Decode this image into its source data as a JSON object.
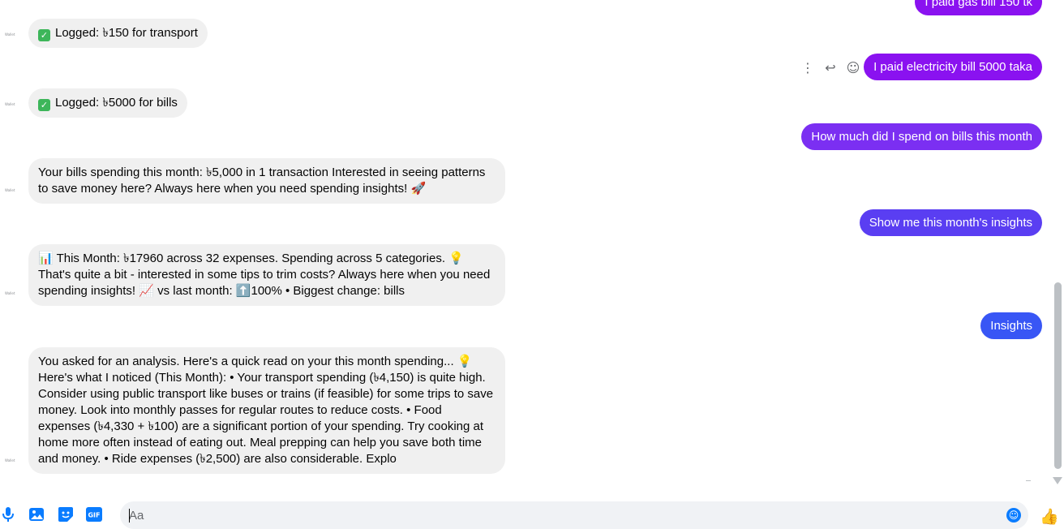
{
  "messages": {
    "out0": "I paid gas bill 150 tk",
    "in0": "Logged: ৳150 for transport",
    "out1": "I paid electricity bill 5000 taka",
    "in1": "Logged: ৳5000 for bills",
    "out2": "How much did I spend on bills this month",
    "in2": "Your bills spending this month: ৳5,000 in 1 transaction Interested in seeing patterns to save money here? Always here when you need spending insights! 🚀",
    "out3": "Show me this month's insights",
    "in3": "📊 This Month: ৳17960 across 32 expenses. Spending across 5 categories. 💡 That's quite a bit - interested in some tips to trim costs? Always here when you need spending insights! 📈 vs last month: ⬆️100% • Biggest change: bills",
    "out4": "Insights",
    "in4": "You asked for an analysis. Here's a quick read on your this month spending... 💡 Here's what I noticed (This Month): • Your transport spending (৳4,150) is quite high. Consider using public transport like buses or trains (if feasible) for some trips to save money. Look into monthly passes for regular routes to reduce costs. • Food expenses (৳4,330 + ৳100) are a significant portion of your spending. Try cooking at home more often instead of eating out. Meal prepping can help you save both time and money. • Ridе expenses (৳2,500) are also considerable. Explo"
  },
  "avatar_label": "Wallet",
  "composer": {
    "placeholder": "Aa"
  },
  "colors": {
    "incoming_bg": "#f0f0f0",
    "outgoing_purple": "#8a12f0",
    "outgoing_violet": "#7b2ff2",
    "outgoing_indigo": "#5a3ef2",
    "outgoing_blue": "#3856f5",
    "accent": "#0a7cff"
  },
  "icons": [
    "microphone-icon",
    "image-icon",
    "sticker-icon",
    "gif-icon",
    "emoji-icon",
    "thumbs-up-icon",
    "more-icon",
    "reply-icon",
    "react-icon",
    "check-icon"
  ]
}
